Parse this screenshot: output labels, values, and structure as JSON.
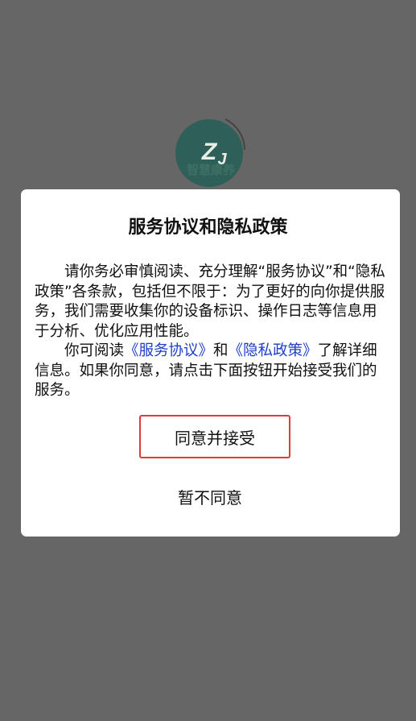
{
  "logo": {
    "icon": "zhihui-kangyang-logo",
    "text": "智慧康养",
    "color": "#3f6f65"
  },
  "dialog": {
    "title": "服务协议和隐私政策",
    "paragraph1": "请你务必审慎阅读、充分理解“服务协议”和“隐私政策”各条款，包括但不限于：为了更好的向你提供服务，我们需要收集你的设备标识、操作日志等信息用于分析、优化应用性能。",
    "paragraph2_prefix": "你可阅读",
    "service_agreement_link": "《服务协议》",
    "paragraph2_and": "和",
    "privacy_policy_link": "《隐私政策》",
    "paragraph2_suffix": "了解详细信息。如果你同意，请点击下面按钮开始接受我们的服务。",
    "agree_label": "同意并接受",
    "decline_label": "暂不同意"
  },
  "colors": {
    "overlay": "#666666",
    "link": "#1f3fc8",
    "agree_border": "#e03a3e"
  }
}
